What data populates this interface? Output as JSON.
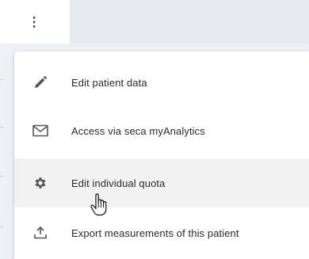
{
  "toolbar": {
    "more_icon": "more-vertical-icon"
  },
  "menu": {
    "items": [
      {
        "label": "Edit patient data",
        "icon": "pencil-icon"
      },
      {
        "label": "Access via seca myAnalytics",
        "icon": "envelope-icon"
      },
      {
        "label": "Edit individual quota",
        "icon": "gear-icon",
        "hovered": true
      },
      {
        "label": "Export measurements of this patient",
        "icon": "upload-icon"
      }
    ]
  },
  "cursor": {
    "icon": "hand-pointer-icon"
  }
}
